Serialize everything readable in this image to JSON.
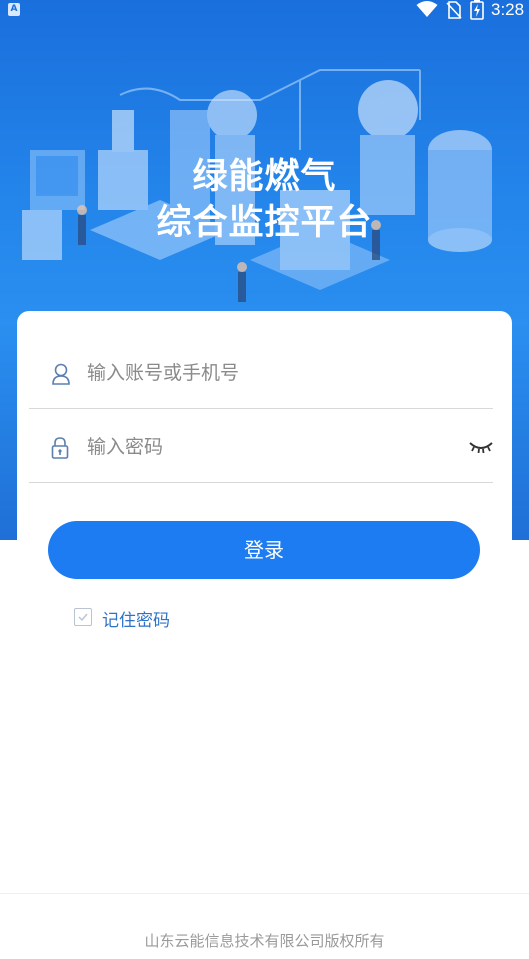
{
  "status_bar": {
    "time": "3:28",
    "app_badge": "A",
    "icons": [
      "wifi-icon",
      "no-sim-icon",
      "battery-charging-icon"
    ]
  },
  "hero": {
    "title_line1": "绿能燃气",
    "title_line2": "综合监控平台"
  },
  "login_form": {
    "username_placeholder": "输入账号或手机号",
    "username_value": "",
    "password_placeholder": "输入密码",
    "password_value": "",
    "login_button": "登录",
    "remember_label": "记住密码",
    "remember_checked": false
  },
  "footer": {
    "copyright": "山东云能信息技术有限公司版权所有"
  },
  "colors": {
    "primary": "#1e7cf2",
    "hero_gradient_top": "#1a6fdc",
    "hero_gradient_bottom": "#1f6fd6",
    "link_text": "#2f73c7"
  }
}
